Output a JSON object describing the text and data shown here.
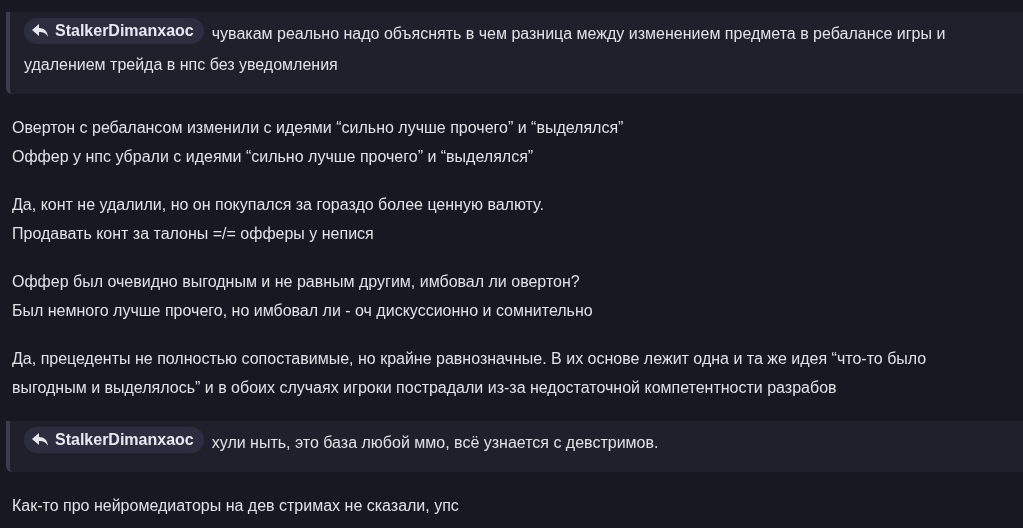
{
  "blocks": [
    {
      "kind": "quote",
      "author": "StalkerDimanxaoc",
      "lines": [
        "чувакам реально надо объяснять в чем разница между изменением предмета в ребалансе игры и",
        "удалением трейда в нпс без уведомления"
      ]
    },
    {
      "kind": "paragraph",
      "lines": [
        "Овертон с ребалансом изменили с идеями “сильно лучше прочего” и “выделялся”",
        "Оффер у нпс убрали с идеями “сильно лучше прочего” и “выделялся”"
      ]
    },
    {
      "kind": "paragraph",
      "lines": [
        "Да, конт не удалили, но он покупался за гораздо более ценную валюту.",
        "Продавать конт за талоны =/= офферы у непися"
      ]
    },
    {
      "kind": "paragraph",
      "lines": [
        "Оффер был очевидно выгодным и не равным другим, имбовал ли овертон?",
        "Был немного лучше прочего, но имбовал ли - оч дискуссионно и сомнительно"
      ]
    },
    {
      "kind": "paragraph",
      "lines": [
        "Да, прецеденты не полностью сопоставимые, но крайне равнозначные. В их основе лежит одна и та же идея “что-то было",
        "выгодным и выделялось” и в обоих случаях игроки пострадали из-за недостаточной компетентности разрабов"
      ]
    },
    {
      "kind": "quote",
      "author": "StalkerDimanxaoc",
      "lines": [
        "хули ныть, это база любой ммо, всё узнается с девстримов."
      ]
    },
    {
      "kind": "paragraph",
      "lines": [
        "Как-то про нейромедиаторы на дев стримах не сказали, упс"
      ]
    }
  ]
}
